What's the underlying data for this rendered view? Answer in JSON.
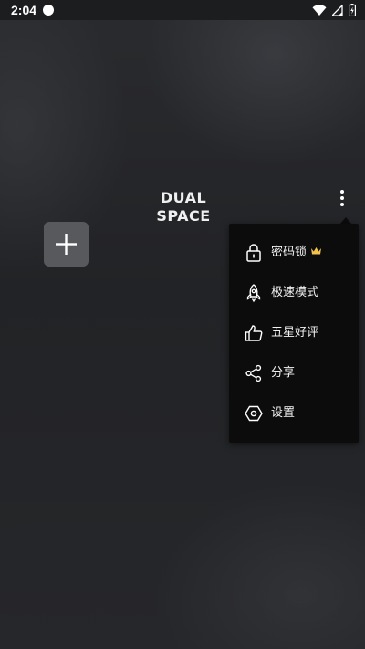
{
  "status_bar": {
    "time": "2:04",
    "icons": [
      "notification-dot-icon",
      "wifi-icon",
      "signal-icon",
      "battery-charging-icon"
    ]
  },
  "app": {
    "logo_text": "DUAL SPACE"
  },
  "add_tile": {
    "icon": "plus-icon"
  },
  "menu": {
    "items": [
      {
        "label": "密码锁",
        "icon": "lock-icon",
        "badge_icon": "crown-icon"
      },
      {
        "label": "极速模式",
        "icon": "rocket-icon"
      },
      {
        "label": "五星好评",
        "icon": "thumbs-up-icon"
      },
      {
        "label": "分享",
        "icon": "share-icon"
      },
      {
        "label": "设置",
        "icon": "settings-hexagon-icon"
      }
    ]
  },
  "colors": {
    "background": "#252628",
    "menu_background": "#0c0c0d",
    "tile_background": "#58595c",
    "crown_accent": "#f2c14e"
  }
}
